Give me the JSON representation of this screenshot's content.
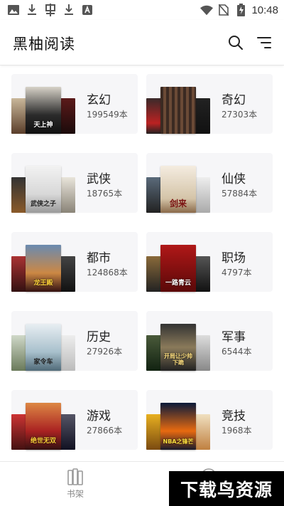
{
  "status_bar": {
    "time": "10:48",
    "icons": [
      "image-icon",
      "download-icon",
      "game-icon",
      "download-icon",
      "a-box-icon",
      "wifi-icon",
      "no-sim-icon",
      "battery-charging-icon"
    ]
  },
  "header": {
    "title": "黑柚阅读",
    "search_icon": "search-icon",
    "menu_icon": "menu-list-icon"
  },
  "categories": [
    {
      "name": "玄幻",
      "count": "199549本",
      "cover_text": "天上神"
    },
    {
      "name": "奇幻",
      "count": "27303本",
      "cover_text": ""
    },
    {
      "name": "武侠",
      "count": "18765本",
      "cover_text": "武侠之子"
    },
    {
      "name": "仙侠",
      "count": "57884本",
      "cover_text": "剑来"
    },
    {
      "name": "都市",
      "count": "124868本",
      "cover_text": "龙王殿"
    },
    {
      "name": "职场",
      "count": "4797本",
      "cover_text": "一路青云"
    },
    {
      "name": "历史",
      "count": "27926本",
      "cover_text": "家令车"
    },
    {
      "name": "军事",
      "count": "6544本",
      "cover_text": "开局让少帅下跪"
    },
    {
      "name": "游戏",
      "count": "27866本",
      "cover_text": "绝世无双"
    },
    {
      "name": "竞技",
      "count": "1968本",
      "cover_text": "NBA之锋芒"
    }
  ],
  "bottom_nav": {
    "shelf_label": "书架",
    "shelf_icon": "bookshelf-icon"
  },
  "watermark": {
    "text": "下载鸟资源"
  },
  "colors": {
    "card_bg": "#f6f6f8",
    "title": "#111111",
    "count": "#555555",
    "watermark_bg": "#000000"
  }
}
